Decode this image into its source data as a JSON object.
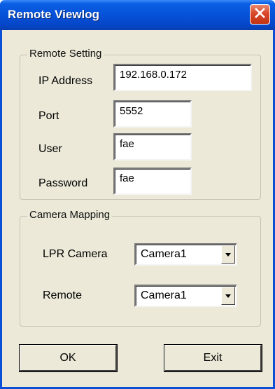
{
  "window": {
    "title": "Remote Viewlog",
    "close_icon": "close-icon"
  },
  "remote_setting": {
    "group_label": "Remote Setting",
    "ip_label": "IP Address",
    "ip_value": "192.168.0.172",
    "port_label": "Port",
    "port_value": "5552",
    "user_label": "User",
    "user_value": "fae",
    "password_label": "Password",
    "password_value": "fae"
  },
  "camera_mapping": {
    "group_label": "Camera Mapping",
    "lpr_label": "LPR Camera",
    "lpr_value": "Camera1",
    "remote_label": "Remote",
    "remote_value": "Camera1"
  },
  "buttons": {
    "ok_label": "OK",
    "exit_label": "Exit"
  },
  "colors": {
    "titlebar": "#0652d8",
    "close_button": "#d9472b",
    "dialog_bg": "#ece9d8"
  }
}
